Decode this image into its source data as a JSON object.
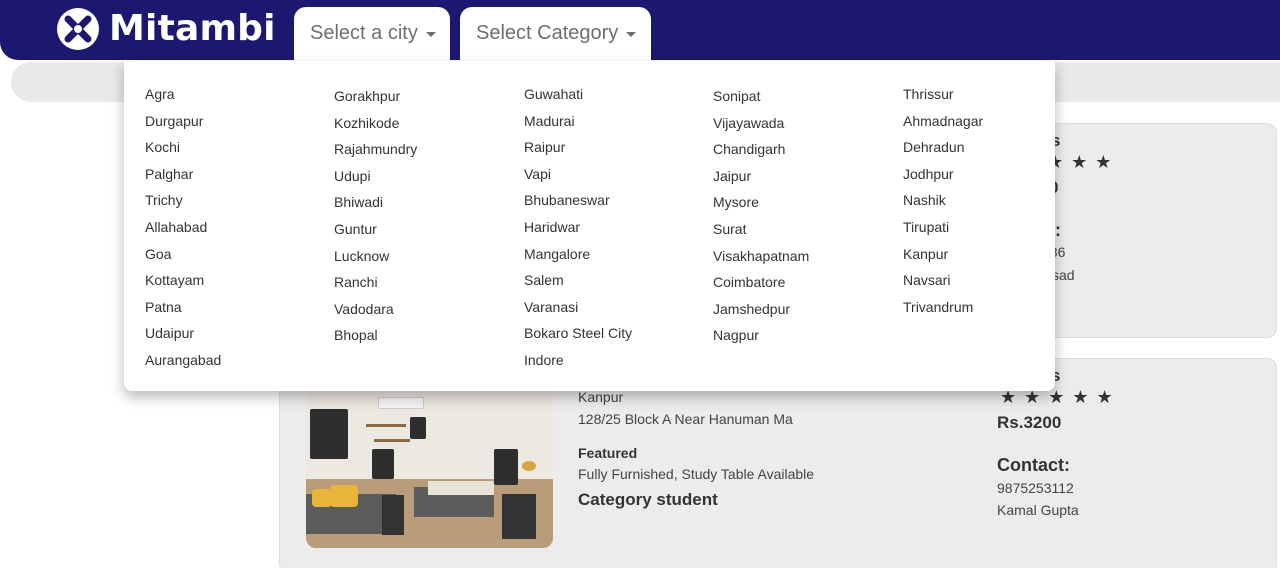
{
  "brand": {
    "name": "Mitambi"
  },
  "nav": {
    "city_select": "Select a city",
    "category_select": "Select Category"
  },
  "city_columns": [
    [
      "Agra",
      "Durgapur",
      "Kochi",
      "Palghar",
      "Trichy",
      "Allahabad",
      "Goa",
      "Kottayam",
      "Patna",
      "Udaipur",
      "Aurangabad"
    ],
    [
      "Gorakhpur",
      "Kozhikode",
      "Rajahmundry",
      "Udupi",
      "Bhiwadi",
      "Guntur",
      "Lucknow",
      "Ranchi",
      "Vadodara",
      "Bhopal"
    ],
    [
      "Guwahati",
      "Madurai",
      "Raipur",
      "Vapi",
      "Bhubaneswar",
      "Haridwar",
      "Mangalore",
      "Salem",
      "Varanasi",
      "Bokaro Steel City",
      "Indore"
    ],
    [
      "Sonipat",
      "Vijayawada",
      "Chandigarh",
      "Jaipur",
      "Mysore",
      "Surat",
      "Visakhapatnam",
      "Coimbatore",
      "Jamshedpur",
      "Nagpur"
    ],
    [
      "Thrissur",
      "Ahmadnagar",
      "Dehradun",
      "Jodhpur",
      "Nashik",
      "Tirupati",
      "Kanpur",
      "Navsari",
      "Trivandrum"
    ]
  ],
  "card1": {
    "rating_label_partial": "s",
    "stars": "★★★",
    "price_partial": "0",
    "contact_partial": "ct:",
    "phone_partial": "686",
    "name_partial": "sad"
  },
  "card2": {
    "city": "Kanpur",
    "address": "128/25 Block A Near Hanuman Ma",
    "featured_label": "Featured",
    "amenities": "Fully Furnished, Study Table Available",
    "category": "Category student",
    "rating_label_partial": "s",
    "stars": "★★★★★",
    "price": "Rs.3200",
    "contact_label": "Contact:",
    "phone": "9875253112",
    "owner": "Kamal Gupta"
  },
  "colors": {
    "navbar": "#1c1870",
    "card_bg": "#ececec",
    "text": "#333333"
  }
}
